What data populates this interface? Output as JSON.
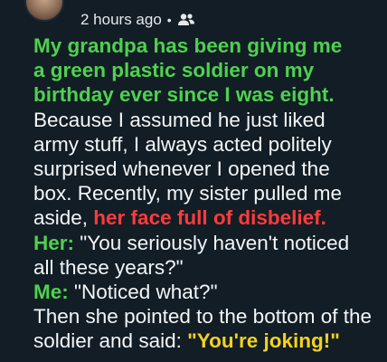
{
  "post": {
    "timestamp": "2 hours ago",
    "separator": "•",
    "audience_icon": "friends-icon"
  },
  "story": {
    "intro_lines": [
      "My grandpa has been giving me",
      "a green plastic soldier on my",
      "birthday ever since I was eight."
    ],
    "body_lines": [
      "Because I assumed he just liked",
      "army stuff, I always acted politely",
      "surprised whenever I opened the",
      "box. Recently, my sister pulled me"
    ],
    "aside_prefix": "aside, ",
    "aside_highlight": "her face full of disbelief.",
    "her_label": "Her:",
    "her_quote_line1": " \"You seriously haven't noticed",
    "her_quote_line2": "all these years?\"",
    "me_label": "Me:",
    "me_quote": " \"Noticed what?\"",
    "closing_line": "Then she pointed to the bottom of the",
    "cut_line_prefix": "soldier and said: ",
    "cut_line_highlight": "\"You're joking!\""
  },
  "colors": {
    "background": "#121d26",
    "text": "#f4f6f7",
    "intro": "#4fd14f",
    "highlight_red": "#ff3b3b",
    "speaker": "#4fd14f",
    "highlight_yellow": "#f2d21f"
  }
}
